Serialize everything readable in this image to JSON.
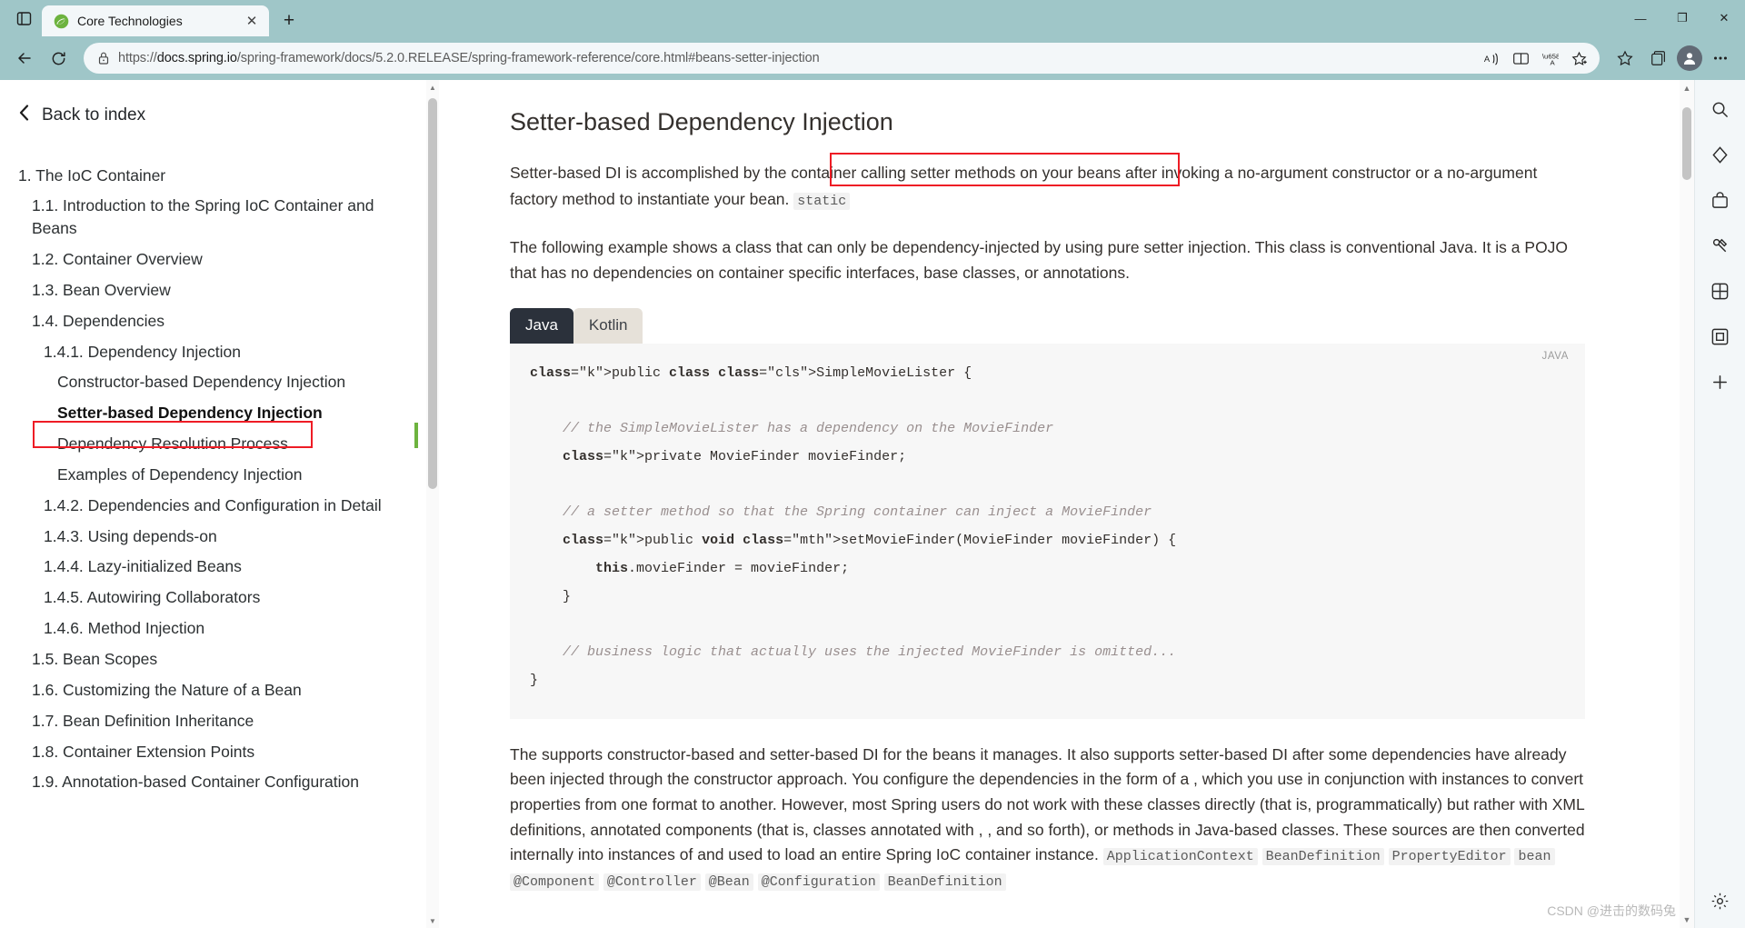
{
  "window": {
    "minimize_label": "—",
    "maximize_label": "❐",
    "close_label": "✕"
  },
  "tabstrip": {
    "tab_search_icon": "tab-actions-icon",
    "tabs": [
      {
        "title": "Core Technologies",
        "favicon": "spring-leaf-icon",
        "close_label": "✕",
        "active": true
      }
    ],
    "new_tab_label": "+"
  },
  "toolbar": {
    "back_label": "←",
    "reload_label": "⟳",
    "lock_icon": "lock-icon",
    "url_prefix": "https://",
    "url_host": "docs.spring.io",
    "url_path": "/spring-framework/docs/5.2.0.RELEASE/spring-framework-reference/core.html#beans-setter-injection",
    "url_full": "https://docs.spring.io/spring-framework/docs/5.2.0.RELEASE/spring-framework-reference/core.html#beans-setter-injection",
    "actions": [
      {
        "name": "read-aloud-icon",
        "label": "Aᵈ"
      },
      {
        "name": "immersive-reader-icon",
        "label": "▤"
      },
      {
        "name": "translate-icon",
        "label": "文A"
      },
      {
        "name": "add-favorite-icon",
        "label": "☆+"
      },
      {
        "name": "favorites-icon",
        "label": "☆"
      },
      {
        "name": "collections-icon",
        "label": "⧉"
      },
      {
        "name": "profile-avatar",
        "label": "●"
      },
      {
        "name": "settings-more-icon",
        "label": "⋯"
      }
    ]
  },
  "sidebar": {
    "back_label": "Back to index",
    "back_chevron": "‹",
    "items": [
      {
        "label": "1. The IoC Container",
        "level": 1,
        "current": false
      },
      {
        "label": "1.1. Introduction to the Spring IoC Container and Beans",
        "level": 2,
        "current": false
      },
      {
        "label": "1.2. Container Overview",
        "level": 2,
        "current": false
      },
      {
        "label": "1.3. Bean Overview",
        "level": 2,
        "current": false
      },
      {
        "label": "1.4. Dependencies",
        "level": 2,
        "current": false
      },
      {
        "label": "1.4.1. Dependency Injection",
        "level": 3,
        "current": false
      },
      {
        "label": "Constructor-based Dependency Injection",
        "level": 4,
        "current": false
      },
      {
        "label": "Setter-based Dependency Injection",
        "level": 4,
        "current": true
      },
      {
        "label": "Dependency Resolution Process",
        "level": 4,
        "current": false
      },
      {
        "label": "Examples of Dependency Injection",
        "level": 4,
        "current": false
      },
      {
        "label": "1.4.2. Dependencies and Configuration in Detail",
        "level": 3,
        "current": false
      },
      {
        "label": "1.4.3. Using depends-on",
        "level": 3,
        "current": false
      },
      {
        "label": "1.4.4. Lazy-initialized Beans",
        "level": 3,
        "current": false
      },
      {
        "label": "1.4.5. Autowiring Collaborators",
        "level": 3,
        "current": false
      },
      {
        "label": "1.4.6. Method Injection",
        "level": 3,
        "current": false
      },
      {
        "label": "1.5. Bean Scopes",
        "level": 2,
        "current": false
      },
      {
        "label": "1.6. Customizing the Nature of a Bean",
        "level": 2,
        "current": false
      },
      {
        "label": "1.7. Bean Definition Inheritance",
        "level": 2,
        "current": false
      },
      {
        "label": "1.8. Container Extension Points",
        "level": 2,
        "current": false
      },
      {
        "label": "1.9. Annotation-based Container Configuration",
        "level": 2,
        "current": false
      }
    ]
  },
  "article": {
    "title": "Setter-based Dependency Injection",
    "paragraph1_a": "Setter-based DI is accomplished by the container calling setter methods on your beans after invoking a no-argument constructor or a no-argument factory method to instantiate your bean.",
    "paragraph1_code": "static",
    "paragraph2": "The following example shows a class that can only be dependency-injected by using pure setter injection. This class is conventional Java. It is a POJO that has no dependencies on container specific interfaces, base classes, or annotations.",
    "code_tabs": [
      {
        "label": "Java",
        "active": true
      },
      {
        "label": "Kotlin",
        "active": false
      }
    ],
    "code_lang_badge": "JAVA",
    "code_lines": [
      "public class SimpleMovieLister {",
      "",
      "    // the SimpleMovieLister has a dependency on the MovieFinder",
      "    private MovieFinder movieFinder;",
      "",
      "    // a setter method so that the Spring container can inject a MovieFinder",
      "    public void setMovieFinder(MovieFinder movieFinder) {",
      "        this.movieFinder = movieFinder;",
      "    }",
      "",
      "    // business logic that actually uses the injected MovieFinder is omitted...",
      "}"
    ],
    "bottom_paragraph": "The supports constructor-based and setter-based DI for the beans it manages. It also supports setter-based DI after some dependencies have already been injected through the constructor approach. You configure the dependencies in the form of a , which you use in conjunction with instances to convert properties from one format to another. However, most Spring users do not work with these classes directly (that is, programmatically) but rather with XML definitions, annotated components (that is, classes annotated with , , and so forth), or methods in Java-based classes. These sources are then converted internally into instances of and used to load an entire Spring IoC container instance.",
    "bottom_inline_codes": [
      "ApplicationContext",
      "BeanDefinition",
      "PropertyEditor",
      "bean",
      "@Component",
      "@Controller",
      "@Bean",
      "@Configuration",
      "BeanDefinition"
    ]
  },
  "edge_sidebar": {
    "icons": [
      {
        "name": "search-icon",
        "label": "⌕"
      },
      {
        "name": "discover-icon",
        "label": "◇"
      },
      {
        "name": "shopping-icon",
        "label": "▤"
      },
      {
        "name": "tools-icon",
        "label": "⚙"
      },
      {
        "name": "games-icon",
        "label": "▣"
      },
      {
        "name": "office-icon",
        "label": "▦"
      },
      {
        "name": "add-sidebar-icon",
        "label": "+"
      }
    ],
    "settings_icon": {
      "name": "sidebar-settings-icon",
      "label": "⚙"
    }
  },
  "watermark": "CSDN @进击的数码兔"
}
